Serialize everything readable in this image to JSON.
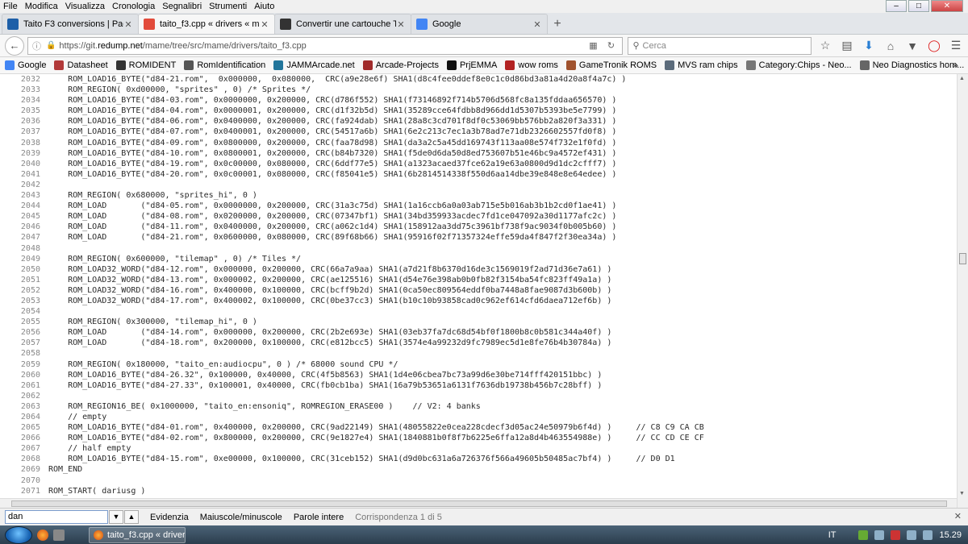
{
  "menu": [
    "File",
    "Modifica",
    "Visualizza",
    "Cronologia",
    "Segnalibri",
    "Strumenti",
    "Aiuto"
  ],
  "tabs": [
    {
      "title": "Taito F3 conversions | Page...",
      "icon": "hp-favicon-icon",
      "color": "#1d5fa8",
      "active": false
    },
    {
      "title": "taito_f3.cpp « drivers « ma...",
      "icon": "git-favicon-icon",
      "color": "#e24b3b",
      "active": true
    },
    {
      "title": "Convertir une cartouche TA...",
      "icon": "site-favicon-icon",
      "color": "#333333",
      "active": false
    },
    {
      "title": "Google",
      "icon": "google-favicon-icon",
      "color": "#4285f4",
      "active": false
    }
  ],
  "nav": {
    "url_prefix": "https://git.",
    "url_domain": "redump.net",
    "url_path": "/mame/tree/src/mame/drivers/taito_f3.cpp",
    "search_placeholder": "Cerca"
  },
  "bookmarks": [
    {
      "label": "Google",
      "color": "#4285f4"
    },
    {
      "label": "Datasheet",
      "color": "#b23a3a"
    },
    {
      "label": "ROMIDENT",
      "color": "#333333"
    },
    {
      "label": "RomIdentification",
      "color": "#555555"
    },
    {
      "label": "JAMMArcade.net",
      "color": "#21759b"
    },
    {
      "label": "Arcade-Projects",
      "color": "#a12c2c"
    },
    {
      "label": "PrjEMMA",
      "color": "#111111"
    },
    {
      "label": "wow roms",
      "color": "#b22222"
    },
    {
      "label": "GameTronik ROMS",
      "color": "#a0522d"
    },
    {
      "label": "MVS ram chips",
      "color": "#5b6b7b"
    },
    {
      "label": "Category:Chips - Neo...",
      "color": "#777777"
    },
    {
      "label": "Neo Diagnostics hom...",
      "color": "#666666"
    }
  ],
  "code": [
    {
      "n": "2032",
      "t": "    ROM_LOAD16_BYTE(\"d84-21.rom\",  0x000000,  0x080000,  CRC(a9e28e6f) SHA1(d8c4fee0ddef8e0c1c0d86bd3a81a4d20a8f4a7c) )"
    },
    {
      "n": "2033",
      "t": "    ROM_REGION( 0xd00000, \"sprites\" , 0) /* Sprites */"
    },
    {
      "n": "2034",
      "t": "    ROM_LOAD16_BYTE(\"d84-03.rom\", 0x0000000, 0x200000, CRC(d786f552) SHA1(f73146892f714b5706d568fc8a135fddaa656570) )"
    },
    {
      "n": "2035",
      "t": "    ROM_LOAD16_BYTE(\"d84-04.rom\", 0x0000001, 0x200000, CRC(d1f32b5d) SHA1(35289cce64fdbb8d966dd1d5307b5393be5e7799) )"
    },
    {
      "n": "2036",
      "t": "    ROM_LOAD16_BYTE(\"d84-06.rom\", 0x0400000, 0x200000, CRC(fa924dab) SHA1(28a8c3cd701f8df0c53069bb576bb2a820f3a331) )"
    },
    {
      "n": "2037",
      "t": "    ROM_LOAD16_BYTE(\"d84-07.rom\", 0x0400001, 0x200000, CRC(54517a6b) SHA1(6e2c213c7ec1a3b78ad7e71db2326602557fd0f8) )"
    },
    {
      "n": "2038",
      "t": "    ROM_LOAD16_BYTE(\"d84-09.rom\", 0x0800000, 0x200000, CRC(faa78d98) SHA1(da3a2c5a45dd169743f113aa08e574f732e1f0fd) )"
    },
    {
      "n": "2039",
      "t": "    ROM_LOAD16_BYTE(\"d84-10.rom\", 0x0800001, 0x200000, CRC(b84b7320) SHA1(f5de0d6da50d8ed753607b51e46bc9a4572ef431) )"
    },
    {
      "n": "2040",
      "t": "    ROM_LOAD16_BYTE(\"d84-19.rom\", 0x0c00000, 0x080000, CRC(6ddf77e5) SHA1(a1323acaed37fce62a19e63a0800d9d1dc2cfff7) )"
    },
    {
      "n": "2041",
      "t": "    ROM_LOAD16_BYTE(\"d84-20.rom\", 0x0c00001, 0x080000, CRC(f85041e5) SHA1(6b2814514338f550d6aa14dbe39e848e8e64edee) )"
    },
    {
      "n": "2042",
      "t": ""
    },
    {
      "n": "2043",
      "t": "    ROM_REGION( 0x680000, \"sprites_hi\", 0 )"
    },
    {
      "n": "2044",
      "t": "    ROM_LOAD       (\"d84-05.rom\", 0x0000000, 0x200000, CRC(31a3c75d) SHA1(1a16ccb6a0a03ab715e5b016ab3b1b2cd0f1ae41) )"
    },
    {
      "n": "2045",
      "t": "    ROM_LOAD       (\"d84-08.rom\", 0x0200000, 0x200000, CRC(07347bf1) SHA1(34bd359933acdec7fd1ce047092a30d1177afc2c) )"
    },
    {
      "n": "2046",
      "t": "    ROM_LOAD       (\"d84-11.rom\", 0x0400000, 0x200000, CRC(a062c1d4) SHA1(158912aa3dd75c3961bf738f9ac9034f0b005b60) )"
    },
    {
      "n": "2047",
      "t": "    ROM_LOAD       (\"d84-21.rom\", 0x0600000, 0x080000, CRC(89f68b66) SHA1(95916f02f71357324effe59da4f847f2f30ea34a) )"
    },
    {
      "n": "2048",
      "t": ""
    },
    {
      "n": "2049",
      "t": "    ROM_REGION( 0x600000, \"tilemap\" , 0) /* Tiles */"
    },
    {
      "n": "2050",
      "t": "    ROM_LOAD32_WORD(\"d84-12.rom\", 0x000000, 0x200000, CRC(66a7a9aa) SHA1(a7d21f8b6370d16de3c1569019f2ad71d36e7a61) )"
    },
    {
      "n": "2051",
      "t": "    ROM_LOAD32_WORD(\"d84-13.rom\", 0x000002, 0x200000, CRC(ae125516) SHA1(d54e76e398ab0b0fb82f3154ba54fc823ff49a1a) )"
    },
    {
      "n": "2052",
      "t": "    ROM_LOAD32_WORD(\"d84-16.rom\", 0x400000, 0x100000, CRC(bcff9b2d) SHA1(0ca50ec809564eddf0ba7448a8fae9087d3b600b) )"
    },
    {
      "n": "2053",
      "t": "    ROM_LOAD32_WORD(\"d84-17.rom\", 0x400002, 0x100000, CRC(0be37cc3) SHA1(b10c10b93858cad0c962ef614cfd6daea712ef6b) )"
    },
    {
      "n": "2054",
      "t": ""
    },
    {
      "n": "2055",
      "t": "    ROM_REGION( 0x300000, \"tilemap_hi\", 0 )"
    },
    {
      "n": "2056",
      "t": "    ROM_LOAD       (\"d84-14.rom\", 0x000000, 0x200000, CRC(2b2e693e) SHA1(03eb37fa7dc68d54bf0f1800b8c0b581c344a40f) )"
    },
    {
      "n": "2057",
      "t": "    ROM_LOAD       (\"d84-18.rom\", 0x200000, 0x100000, CRC(e812bcc5) SHA1(3574e4a99232d9fc7989ec5d1e8fe76b4b30784a) )"
    },
    {
      "n": "2058",
      "t": ""
    },
    {
      "n": "2059",
      "t": "    ROM_REGION( 0x180000, \"taito_en:audiocpu\", 0 ) /* 68000 sound CPU */"
    },
    {
      "n": "2060",
      "t": "    ROM_LOAD16_BYTE(\"d84-26.32\", 0x100000, 0x40000, CRC(4f5b8563) SHA1(1d4e06cbea7bc73a99d6e30be714fff420151bbc) )"
    },
    {
      "n": "2061",
      "t": "    ROM_LOAD16_BYTE(\"d84-27.33\", 0x100001, 0x40000, CRC(fb0cb1ba) SHA1(16a79b53651a6131f7636db19738b456b7c28bff) )"
    },
    {
      "n": "2062",
      "t": ""
    },
    {
      "n": "2063",
      "t": "    ROM_REGION16_BE( 0x1000000, \"taito_en:ensoniq\", ROMREGION_ERASE00 )    // V2: 4 banks"
    },
    {
      "n": "2064",
      "t": "    // empty"
    },
    {
      "n": "2065",
      "t": "    ROM_LOAD16_BYTE(\"d84-01.rom\", 0x400000, 0x200000, CRC(9ad22149) SHA1(48055822e0cea228cdecf3d05ac24e50979b6f4d) )     // C8 C9 CA CB"
    },
    {
      "n": "2066",
      "t": "    ROM_LOAD16_BYTE(\"d84-02.rom\", 0x800000, 0x200000, CRC(9e1827e4) SHA1(1840881b0f8f7b6225e6ffa12a8d4b463554988e) )     // CC CD CE CF"
    },
    {
      "n": "2067",
      "t": "    // half empty"
    },
    {
      "n": "2068",
      "t": "    ROM_LOAD16_BYTE(\"d84-15.rom\", 0xe00000, 0x100000, CRC(31ceb152) SHA1(d9d0bc631a6a726376f566a49605b50485ac7bf4) )     // D0 D1"
    },
    {
      "n": "2069",
      "t": "ROM_END"
    },
    {
      "n": "2070",
      "t": ""
    },
    {
      "n": "2071",
      "t": "ROM_START( dariusg )"
    }
  ],
  "find": {
    "value": "dan",
    "options": [
      "Evidenzia",
      "Maiuscole/minuscole",
      "Parole intere"
    ],
    "status": "Corrispondenza 1 di 5"
  },
  "taskbar": {
    "task_title": "taito_f3.cpp « drivers...",
    "lang": "IT",
    "clock": "15.29"
  }
}
